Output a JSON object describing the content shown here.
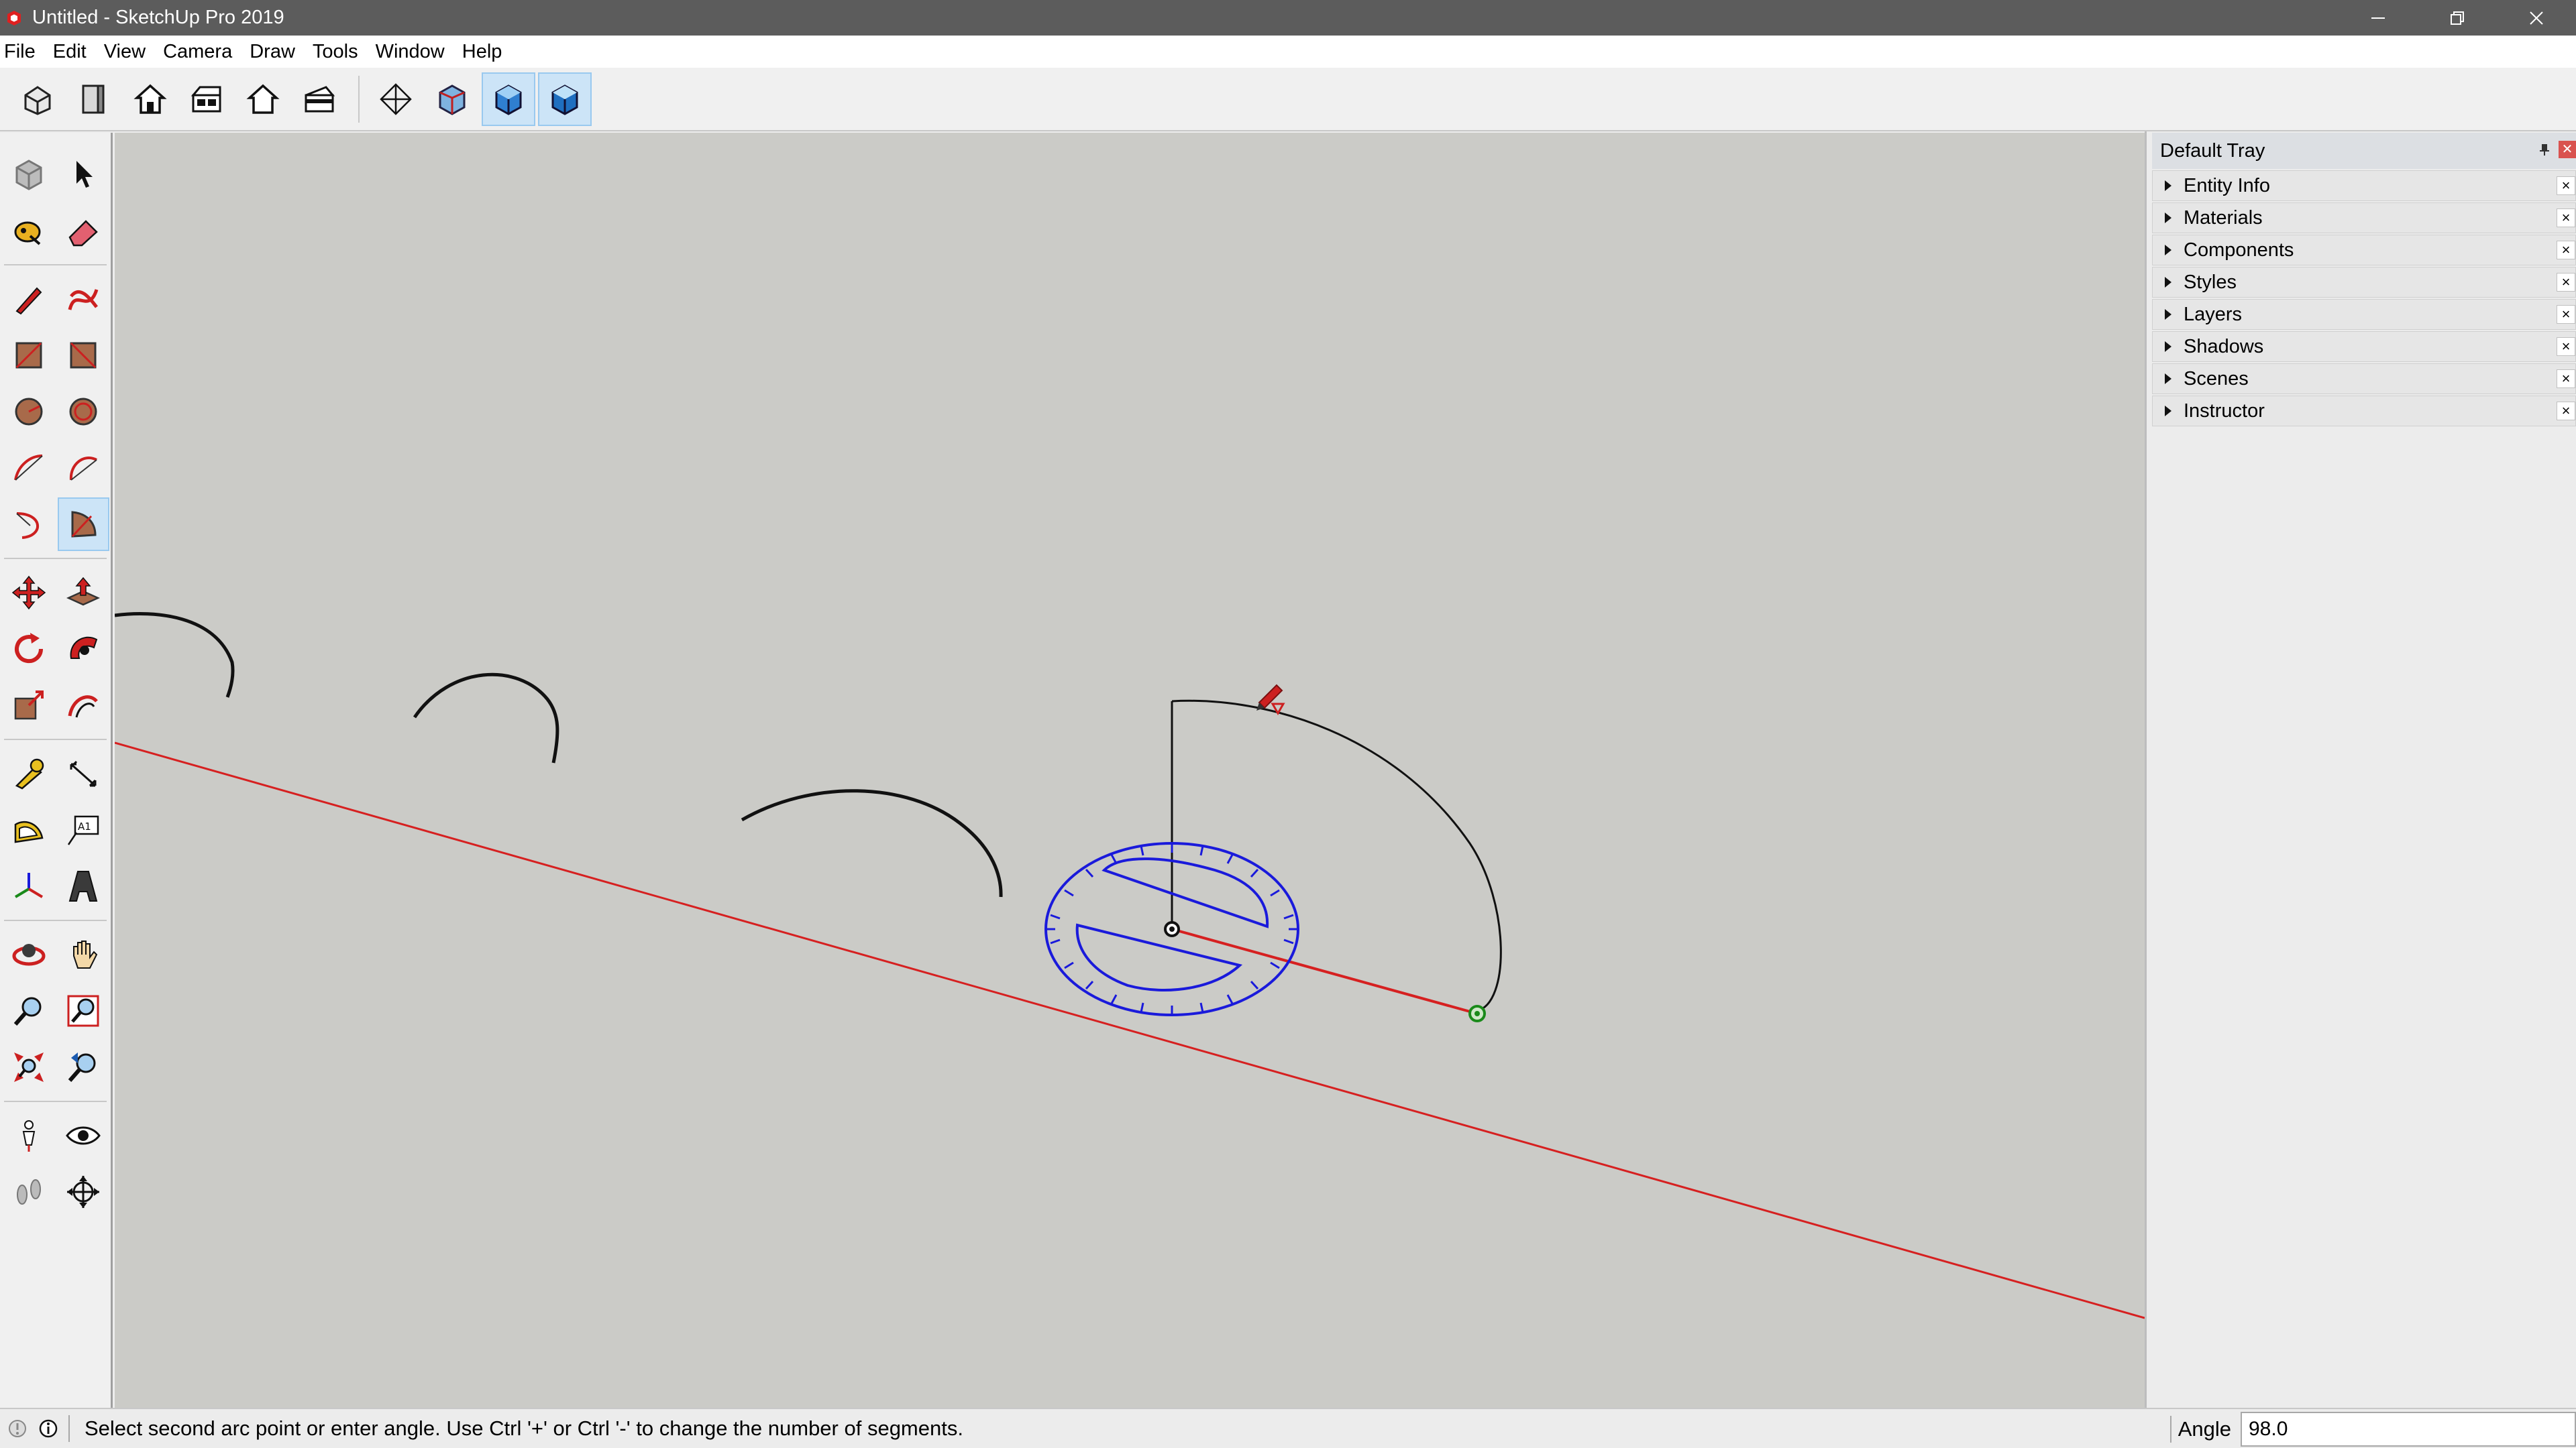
{
  "window": {
    "title": "Untitled - SketchUp Pro 2019",
    "app_icon": "sketchup-logo-icon",
    "controls": [
      "minimize-icon",
      "restore-icon",
      "close-icon"
    ]
  },
  "menu": {
    "items": [
      "File",
      "Edit",
      "View",
      "Camera",
      "Draw",
      "Tools",
      "Window",
      "Help"
    ]
  },
  "top_toolbar": {
    "buttons": [
      {
        "icon": "iso-view-icon"
      },
      {
        "icon": "top-view-icon"
      },
      {
        "icon": "front-view-icon"
      },
      {
        "icon": "right-view-icon"
      },
      {
        "icon": "back-view-icon"
      },
      {
        "icon": "left-view-icon"
      },
      {
        "icon": "xray-icon"
      },
      {
        "icon": "back-edges-icon"
      },
      {
        "icon": "shaded-icon",
        "active": true
      },
      {
        "icon": "shaded-textures-icon",
        "active": true
      }
    ]
  },
  "left_toolbar": {
    "tools": [
      "make-component-icon",
      "select-icon",
      "paint-bucket-icon",
      "eraser-icon",
      "line-icon",
      "freehand-icon",
      "rectangle-icon",
      "rotated-rectangle-icon",
      "circle-icon",
      "polygon-icon",
      "arc-icon",
      "two-point-arc-icon",
      "three-point-arc-icon",
      "pie-icon",
      "move-icon",
      "push-pull-icon",
      "rotate-icon",
      "follow-me-icon",
      "scale-icon",
      "offset-icon",
      "tape-measure-icon",
      "dimension-icon",
      "protractor-icon",
      "text-icon",
      "axes-icon",
      "3d-text-icon",
      "orbit-icon",
      "pan-icon",
      "zoom-icon",
      "zoom-window-icon",
      "zoom-extents-icon",
      "previous-view-icon",
      "position-camera-icon",
      "look-around-icon",
      "walk-icon",
      "section-plane-icon"
    ],
    "active_tool": "pie-icon"
  },
  "tray": {
    "title": "Default Tray",
    "panels": [
      "Entity Info",
      "Materials",
      "Components",
      "Styles",
      "Layers",
      "Shadows",
      "Scenes",
      "Instructor"
    ]
  },
  "status": {
    "message": "Select second arc point or enter angle. Use Ctrl '+' or Ctrl '-' to change the number of segments.",
    "vcb_label": "Angle",
    "vcb_value": "98.0"
  },
  "colors": {
    "viewport_bg": "#cbcbc7",
    "red_axis": "#d62020",
    "protractor": "#1a1adb",
    "endpoint": "#1a8a1a",
    "brand_red": "#d0021b"
  }
}
